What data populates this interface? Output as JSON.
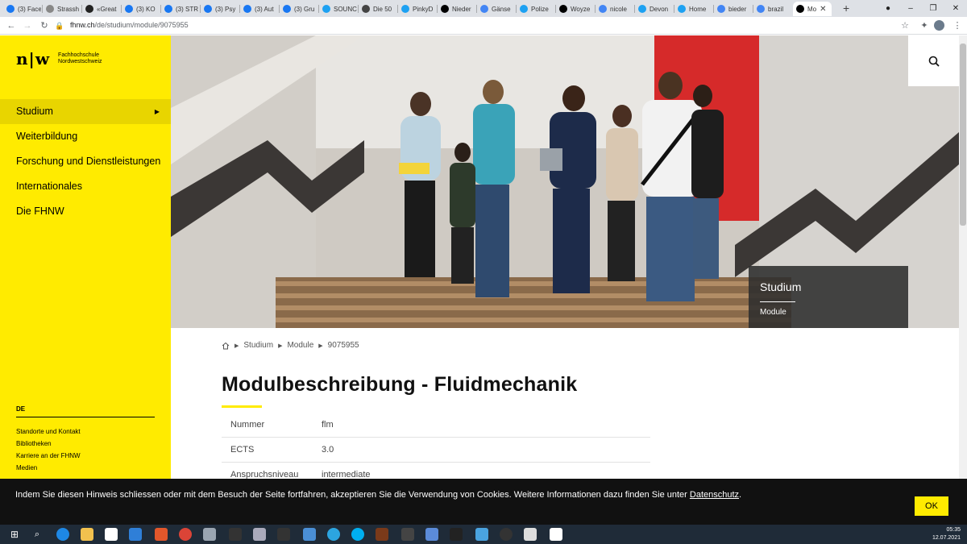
{
  "browser": {
    "tabs": [
      {
        "label": "(3) Face",
        "color": "#1877f2"
      },
      {
        "label": "Strassh",
        "color": "#888888"
      },
      {
        "label": "«Great",
        "color": "#222222"
      },
      {
        "label": "(3) KO",
        "color": "#1877f2"
      },
      {
        "label": "(3) STR",
        "color": "#1877f2"
      },
      {
        "label": "(3) Psy",
        "color": "#1877f2"
      },
      {
        "label": "(3) Aut",
        "color": "#1877f2"
      },
      {
        "label": "(3) Gru",
        "color": "#1877f2"
      },
      {
        "label": "SOUNC",
        "color": "#1da1f2"
      },
      {
        "label": "Die 50",
        "color": "#444444"
      },
      {
        "label": "PinkyD",
        "color": "#1da1f2"
      },
      {
        "label": "Nieder",
        "color": "#000000"
      },
      {
        "label": "Gänse",
        "color": "#4285f4"
      },
      {
        "label": "Polize",
        "color": "#1da1f2"
      },
      {
        "label": "Woyze",
        "color": "#000000"
      },
      {
        "label": "nicole",
        "color": "#4285f4"
      },
      {
        "label": "Devon",
        "color": "#1da1f2"
      },
      {
        "label": "Home",
        "color": "#1da1f2"
      },
      {
        "label": "bieder",
        "color": "#4285f4"
      },
      {
        "label": "brazil",
        "color": "#4285f4"
      },
      {
        "label": "Mo",
        "color": "#000000",
        "active": true
      }
    ],
    "url_host": "fhnw.ch",
    "url_path": "/de/studium/module/9075955"
  },
  "logo": {
    "mark": "n|w",
    "name_line1": "Fachhochschule",
    "name_line2": "Nordwestschweiz"
  },
  "nav": {
    "items": [
      {
        "label": "Studium",
        "active": true
      },
      {
        "label": "Weiterbildung"
      },
      {
        "label": "Forschung und Dienstleistungen"
      },
      {
        "label": "Internationales"
      },
      {
        "label": "Die FHNW"
      }
    ]
  },
  "sidebar_footer": {
    "language": "DE",
    "links": [
      "Standorte und Kontakt",
      "Bibliotheken",
      "Karriere an der FHNW",
      "Medien"
    ]
  },
  "hero": {
    "caption_title": "Studium",
    "caption_sub": "Module"
  },
  "breadcrumb": {
    "items": [
      "Studium",
      "Module",
      "9075955"
    ]
  },
  "page": {
    "title": "Modulbeschreibung - Fluidmechanik"
  },
  "module_table": [
    {
      "key": "Nummer",
      "value": "flm"
    },
    {
      "key": "ECTS",
      "value": "3.0"
    },
    {
      "key": "Anspruchsniveau",
      "value": "intermediate"
    }
  ],
  "cookie": {
    "text": "Indem Sie diesen Hinweis schliessen oder mit dem Besuch der Seite fortfahren, akzeptieren Sie die Verwendung von Cookies. Weitere Informationen dazu finden Sie unter ",
    "link": "Datenschutz",
    "suffix": ".",
    "ok": "OK"
  },
  "taskbar": {
    "time": "05:35",
    "date": "12.07.2021"
  },
  "colors": {
    "brand_yellow": "#ffeb00",
    "cookie_bg": "#111111"
  }
}
